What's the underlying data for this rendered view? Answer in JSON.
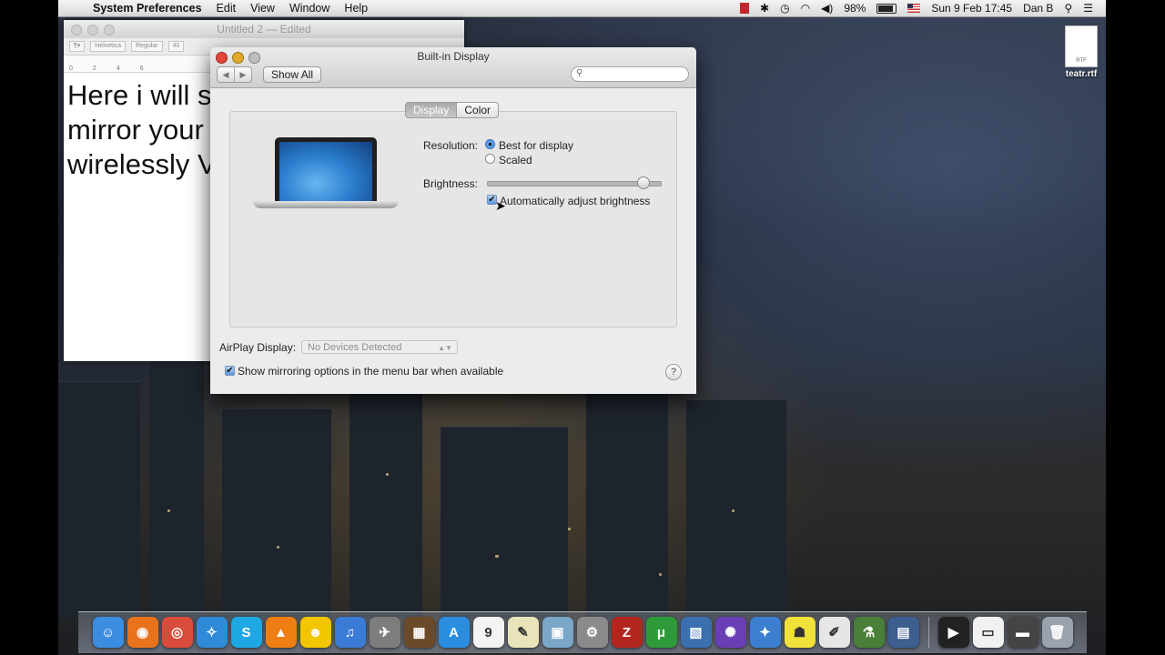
{
  "menubar": {
    "apple": "",
    "app": "System Preferences",
    "items": [
      "Edit",
      "View",
      "Window",
      "Help"
    ],
    "battery": "98%",
    "datetime": "Sun 9 Feb  17:45",
    "user": "Dan B"
  },
  "textedit": {
    "title": "Untitled 2",
    "title_suffix": "— Edited",
    "font": "Helvetica",
    "style": "Regular",
    "size": "40",
    "body": "Here i will s\nmirror your\nwirelessly V"
  },
  "desktop_file": {
    "name": "teatr.rtf",
    "badge": "RTF"
  },
  "prefs": {
    "title": "Built-in Display",
    "show_all": "Show All",
    "search_placeholder": "",
    "tabs": [
      "Display",
      "Color"
    ],
    "resolution_label": "Resolution:",
    "resolution_options": [
      "Best for display",
      "Scaled"
    ],
    "resolution_selected": "Best for display",
    "brightness_label": "Brightness:",
    "brightness_level": 0.9,
    "auto_brightness_label": "Automatically adjust brightness",
    "auto_brightness_checked": true,
    "airplay_label": "AirPlay Display:",
    "airplay_value": "No Devices Detected",
    "mirroring_label": "Show mirroring options in the menu bar when available",
    "mirroring_checked": true,
    "help": "?"
  },
  "dock": [
    {
      "name": "finder",
      "glyph": "☺",
      "color": "#3b8de0"
    },
    {
      "name": "firefox",
      "glyph": "◉",
      "color": "#e8731c"
    },
    {
      "name": "chrome",
      "glyph": "◎",
      "color": "#d94b3a"
    },
    {
      "name": "safari",
      "glyph": "✧",
      "color": "#2f8ad8"
    },
    {
      "name": "skype",
      "glyph": "S",
      "color": "#1fa7e3"
    },
    {
      "name": "vlc",
      "glyph": "▲",
      "color": "#ee7d12"
    },
    {
      "name": "adium",
      "glyph": "☻",
      "color": "#f2c600"
    },
    {
      "name": "itunes",
      "glyph": "♫",
      "color": "#3a7bd5"
    },
    {
      "name": "launchpad",
      "glyph": "✈",
      "color": "#7d7d7d"
    },
    {
      "name": "photo-booth",
      "glyph": "▦",
      "color": "#6b4a2a"
    },
    {
      "name": "app-store",
      "glyph": "A",
      "color": "#2a8de0"
    },
    {
      "name": "calendar",
      "glyph": "9",
      "color": "#f3f3f3"
    },
    {
      "name": "notes",
      "glyph": "✎",
      "color": "#e9e3b9"
    },
    {
      "name": "preview",
      "glyph": "▣",
      "color": "#7aa7c8"
    },
    {
      "name": "system-preferences",
      "glyph": "⚙",
      "color": "#8a8a8a"
    },
    {
      "name": "filezilla",
      "glyph": "Z",
      "color": "#b3261e"
    },
    {
      "name": "utorrent",
      "glyph": "μ",
      "color": "#2f9a3a"
    },
    {
      "name": "image-capture",
      "glyph": "▧",
      "color": "#3a6fb0"
    },
    {
      "name": "app-1",
      "glyph": "✺",
      "color": "#6a3fb5"
    },
    {
      "name": "app-2",
      "glyph": "✦",
      "color": "#3c7fd0"
    },
    {
      "name": "app-3",
      "glyph": "☗",
      "color": "#f0e23a"
    },
    {
      "name": "textedit",
      "glyph": "✐",
      "color": "#e6e6e6"
    },
    {
      "name": "app-4",
      "glyph": "⚗",
      "color": "#4a7f3a"
    },
    {
      "name": "app-5",
      "glyph": "▤",
      "color": "#3c5f8f"
    },
    {
      "name": "divx",
      "glyph": "▶",
      "color": "#222222"
    },
    {
      "name": "document",
      "glyph": "▭",
      "color": "#f1f1f1"
    },
    {
      "name": "app-6",
      "glyph": "▬",
      "color": "#444444"
    },
    {
      "name": "trash",
      "glyph": "🗑",
      "color": "#9aa3ad"
    }
  ]
}
